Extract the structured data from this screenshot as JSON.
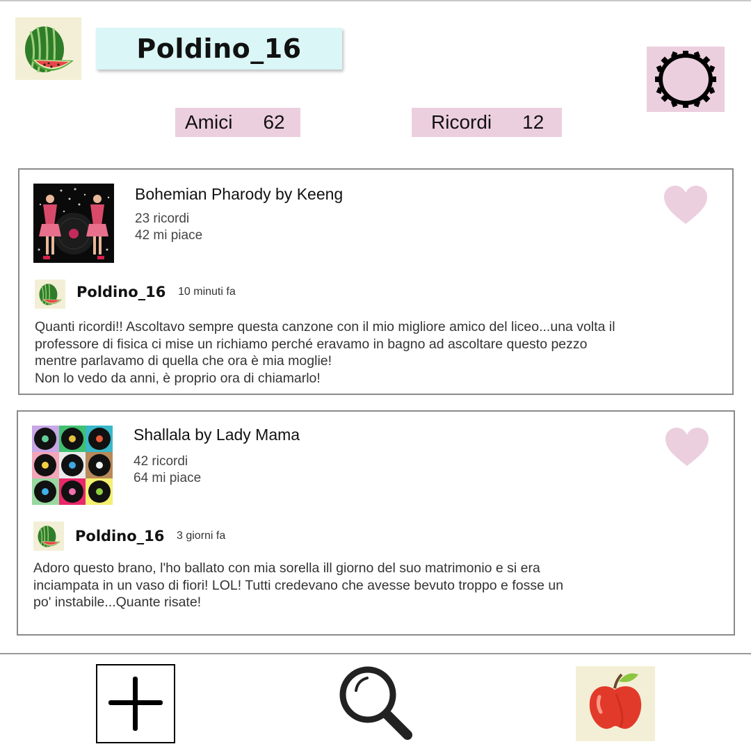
{
  "profile": {
    "username": "Poldino_16",
    "avatar_icon": "watermelon-icon",
    "stats": [
      {
        "label": "Amici",
        "value": "62"
      },
      {
        "label": "Ricordi",
        "value": "12"
      }
    ],
    "settings_icon": "gear-icon"
  },
  "posts": [
    {
      "song_title": "Bohemian Pharody by Keeng",
      "memories": "23 ricordi",
      "likes": "42 mi piace",
      "author": "Poldino_16",
      "time": "10 minuti fa",
      "text": "Quanti ricordi!! Ascoltavo sempre questa canzone con il mio migliore amico del liceo...una volta il\nprofessore di fisica ci mise un richiamo perché eravamo in bagno ad ascoltare questo pezzo\nmentre parlavamo di quella che ora è mia moglie!\nNon lo vedo da anni, è proprio ora di chiamarlo!"
    },
    {
      "song_title": "Shallala by Lady Mama",
      "memories": "42 ricordi",
      "likes": "64 mi piace",
      "author": "Poldino_16",
      "time": "3 giorni fa",
      "text": "Adoro questo brano, l'ho ballato con mia sorella ill giorno del suo matrimonio e si era\ninciampata in un vaso di fiori! LOL! Tutti credevano che avesse bevuto troppo e fosse un\npo' instabile...Quante risate!"
    }
  ],
  "bottom_nav": {
    "items": [
      "add-icon",
      "search-icon",
      "apple-icon"
    ]
  },
  "colors": {
    "username_bg": "#daf6f6",
    "accent_pink": "#eccfdf",
    "heart": "#eccfdf",
    "avatar_bg": "#f3efd6"
  }
}
